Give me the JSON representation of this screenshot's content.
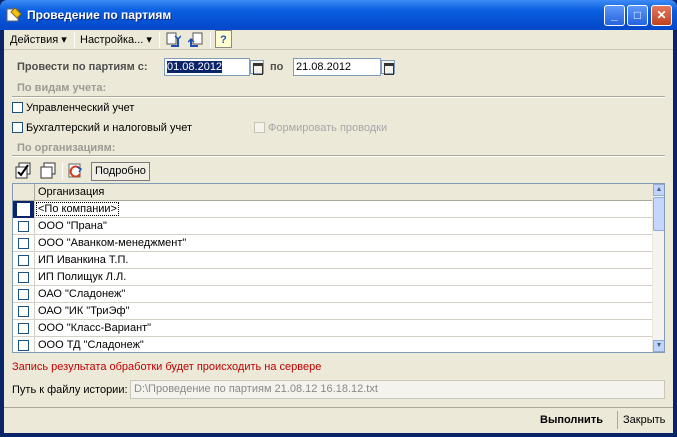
{
  "window": {
    "title": "Проведение по партиям",
    "controls": {
      "minimize": "_",
      "maximize": "□",
      "close": "✕"
    }
  },
  "toolbar": {
    "actions_label": "Действия",
    "settings_label": "Настройка...",
    "help_label": "?"
  },
  "form": {
    "period_label": "Провести по партиям с:",
    "date_from": "01.08.2012",
    "to_label": "по",
    "date_to": "21.08.2012",
    "section_accounting": "По видам учета:",
    "mgmt_accounting_label": "Управленческий учет",
    "mgmt_accounting_checked": false,
    "fin_accounting_label": "Бухгалтерский и налоговый учет",
    "fin_accounting_checked": false,
    "make_entries_label": "Формировать проводки",
    "make_entries_checked": false,
    "section_orgs": "По организациям:",
    "details_label": "Подробно"
  },
  "grid": {
    "column_header": "Организация",
    "rows": [
      {
        "name": "<По компании>",
        "checked": false,
        "focused": true
      },
      {
        "name": "ООО \"Прана\"",
        "checked": false
      },
      {
        "name": "ООО \"Аванком-менеджмент\"",
        "checked": false
      },
      {
        "name": "ИП Иванкина Т.П.",
        "checked": false
      },
      {
        "name": "ИП Полищук Л.Л.",
        "checked": false
      },
      {
        "name": "ОАО \"Сладонеж\"",
        "checked": false
      },
      {
        "name": "ОАО \"ИК \"ТриЭф\"",
        "checked": false
      },
      {
        "name": "ООО \"Класс-Вариант\"",
        "checked": false
      },
      {
        "name": "ООО ТД \"Сладонеж\"",
        "checked": false
      }
    ]
  },
  "footer": {
    "server_note": "Запись результата обработки будет происходить на сервере",
    "history_path_label": "Путь к файлу истории:",
    "history_path_value": "D:\\Проведение по партиям 21.08.12 16.18.12.txt",
    "execute_label": "Выполнить",
    "close_label": "Закрыть"
  }
}
